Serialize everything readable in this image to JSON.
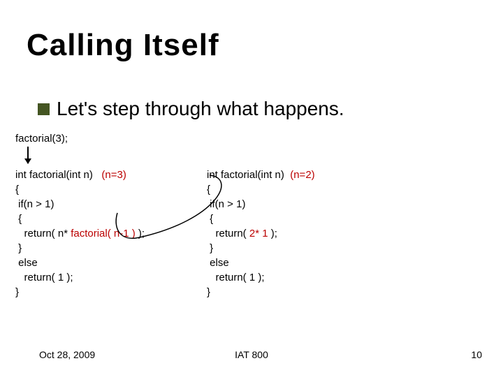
{
  "title": "Calling Itself",
  "bullet": "Let's step through what happens.",
  "call": "factorial(3);",
  "left": {
    "sig_pre": "int factorial(int n)   ",
    "ann": "(n=3)",
    "l1": "{",
    "l2": " if(n > 1)",
    "l3": " {",
    "l4a": "   return( n* ",
    "l4b": "factorial( n-1 )",
    "l4c": " );",
    "l5": " }",
    "l6": " else",
    "l7": "   return( 1 );",
    "l8": "}"
  },
  "right": {
    "sig_pre": "int factorial(int n)  ",
    "ann": "(n=2)",
    "l1": "{",
    "l2": " if(n > 1)",
    "l3": " {",
    "l4a": "   return( ",
    "l4b": "2* 1",
    "l4c": " );",
    "l5": " }",
    "l6": " else",
    "l7": "   return( 1 );",
    "l8": "}"
  },
  "footer": {
    "date": "Oct 28, 2009",
    "center": "IAT 800",
    "page": "10"
  }
}
